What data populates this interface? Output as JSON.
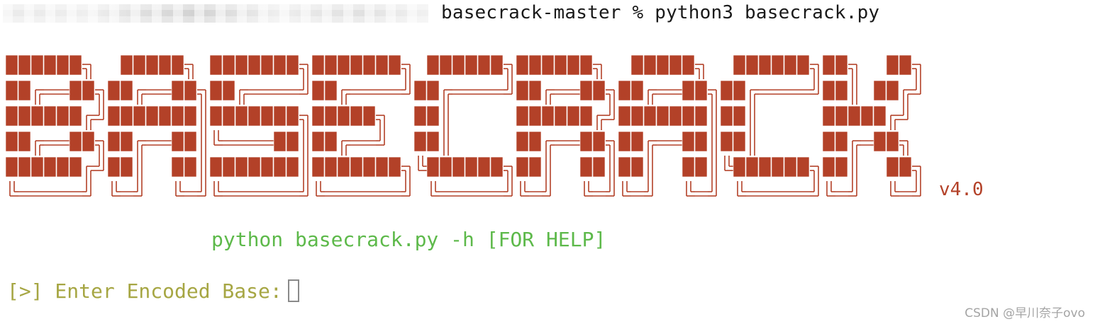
{
  "terminal": {
    "command_line": {
      "redacted_prefix_label": "redacted user@host prompt",
      "command": "basecrack-master % python3 basecrack.py"
    },
    "banner": {
      "text": "BASECRACK",
      "version": "v4.0",
      "block_color": "#b34128"
    },
    "help_text": "python basecrack.py -h [FOR HELP]",
    "input_prompt": "[>] Enter Encoded Base:",
    "colors": {
      "banner": "#b34128",
      "help": "#5db94a",
      "prompt": "#a6a643"
    }
  },
  "watermark": "CSDN @早川奈子ovo"
}
